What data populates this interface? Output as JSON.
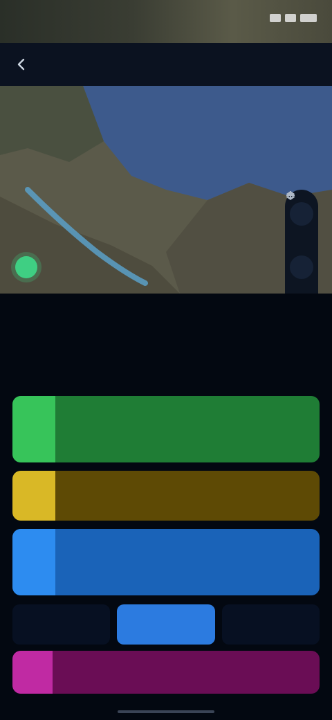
{
  "status_bar": {
    "time": ""
  },
  "header": {
    "title": ""
  },
  "section": {
    "title": "",
    "more": ""
  },
  "stats": [
    {
      "value": ""
    },
    {
      "value": ""
    },
    {
      "value": ""
    }
  ],
  "cards": {
    "green": {
      "title": "",
      "subtitle": "",
      "color": "#1f7d35",
      "accent": "#37c45a"
    },
    "yellow": {
      "title": "",
      "subtitle": "",
      "color": "#5e4a05",
      "accent": "#d9b826"
    },
    "blue": {
      "title": "",
      "subtitle": "",
      "color": "#1a63b8",
      "accent": "#2d8cf0"
    },
    "magenta": {
      "title": "",
      "subtitle": "",
      "color": "#6a0d55",
      "accent": "#c02aa3"
    }
  },
  "segmented": [
    {
      "label": "",
      "active": false
    },
    {
      "label": "",
      "active": true
    },
    {
      "label": "",
      "active": false
    }
  ],
  "icons": {
    "back": "back-arrow-icon",
    "map_controls": [
      "zoom-in-icon",
      "layers-icon",
      "locate-icon"
    ],
    "location_pin": "location-pin-icon"
  },
  "colors": {
    "background": "#030811",
    "header": "#0b1220",
    "accent": "#2c7be0",
    "map_water": "#3d5a8c",
    "route": "#5aa0c8"
  }
}
